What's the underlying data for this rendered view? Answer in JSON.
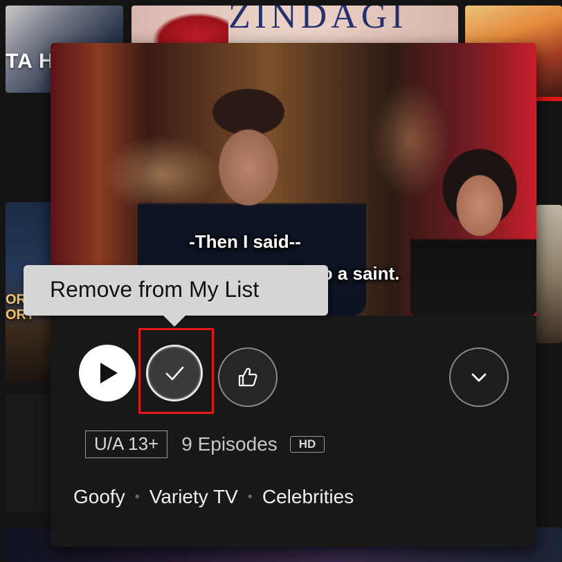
{
  "background_cards": {
    "left_top_wordmark": "TA HA",
    "center_top_wordmark": "ZINDAGI",
    "left_mid_wordmark": "ORLD\nORY"
  },
  "preview": {
    "subtitle_line1": "-Then I said--",
    "subtitle_line2": "...med into a saint."
  },
  "tooltip": {
    "text": "Remove from My List"
  },
  "controls": {
    "play": "play",
    "my_list": "check",
    "like": "thumbs-up",
    "more_info": "chevron-down"
  },
  "meta": {
    "maturity_rating": "U/A 13+",
    "episodes": "9 Episodes",
    "quality": "HD"
  },
  "genres": [
    "Goofy",
    "Variety TV",
    "Celebrities"
  ],
  "colors": {
    "highlight": "#e01818",
    "popup_bg": "#181818",
    "tooltip_bg": "#d6d6d6"
  }
}
